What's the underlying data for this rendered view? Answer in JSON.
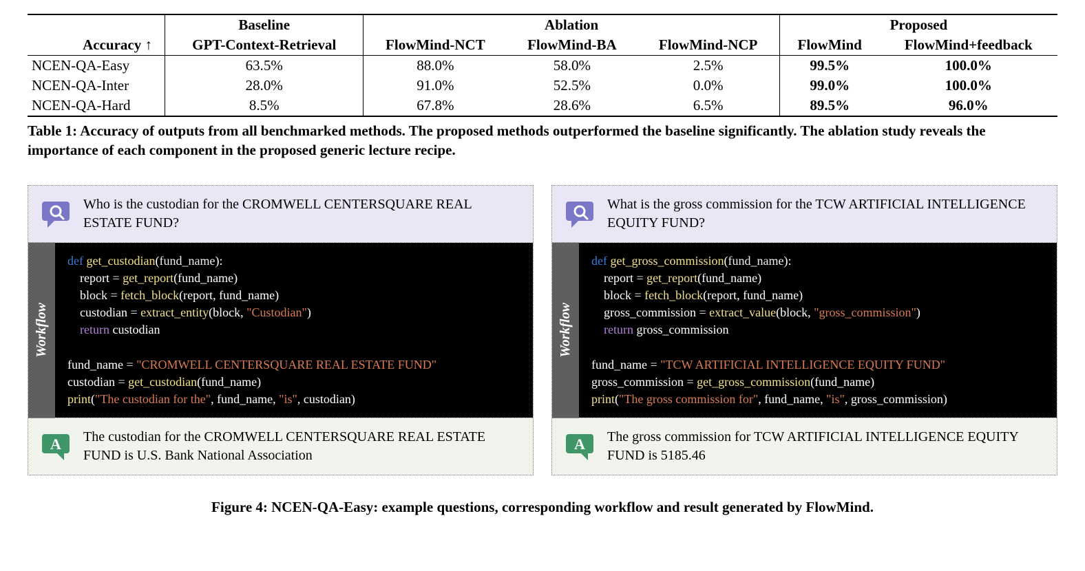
{
  "table": {
    "acc_label": "Accuracy ↑",
    "groups": {
      "baseline": "Baseline",
      "ablation": "Ablation",
      "proposed": "Proposed"
    },
    "cols": {
      "gpt": "GPT-Context-Retrieval",
      "nct": "FlowMind-NCT",
      "ba": "FlowMind-BA",
      "ncp": "FlowMind-NCP",
      "fm": "FlowMind",
      "fmf": "FlowMind+feedback"
    },
    "rows": [
      {
        "label": "NCEN-QA-Easy",
        "gpt": "63.5%",
        "nct": "88.0%",
        "ba": "58.0%",
        "ncp": "2.5%",
        "fm": "99.5%",
        "fmf": "100.0%"
      },
      {
        "label": "NCEN-QA-Inter",
        "gpt": "28.0%",
        "nct": "91.0%",
        "ba": "52.5%",
        "ncp": "0.0%",
        "fm": "99.0%",
        "fmf": "100.0%"
      },
      {
        "label": "NCEN-QA-Hard",
        "gpt": "8.5%",
        "nct": "67.8%",
        "ba": "28.6%",
        "ncp": "6.5%",
        "fm": "89.5%",
        "fmf": "96.0%"
      }
    ],
    "caption": "Table 1: Accuracy of outputs from all benchmarked methods. The proposed methods outperformed the baseline significantly. The ablation study reveals the importance of each component in the proposed generic lecture recipe."
  },
  "examples": [
    {
      "question": "Who is the custodian for the CROMWELL CENTERSQUARE REAL ESTATE FUND?",
      "workflow_label": "Workflow",
      "code_html": "<span class='kw'>def</span> <span class='fn'>get_custodian</span>(<span class='var'>fund_name</span>):\n    report <span class='eq'>=</span> <span class='fn'>get_report</span>(fund_name)\n    block <span class='eq'>=</span> <span class='fn'>fetch_block</span>(report, fund_name)\n    custodian <span class='eq'>=</span> <span class='fn'>extract_entity</span>(block, <span class='str'>\"Custodian\"</span>)\n    <span class='ret'>return</span> custodian\n\nfund_name <span class='eq'>=</span> <span class='str'>\"CROMWELL CENTERSQUARE REAL ESTATE FUND\"</span>\ncustodian <span class='eq'>=</span> <span class='fn'>get_custodian</span>(fund_name)\n<span class='fn'>print</span>(<span class='str'>\"The custodian for the\"</span>, fund_name, <span class='str'>\"is\"</span>, custodian)",
      "answer": "The custodian for the CROMWELL CENTERSQUARE REAL ESTATE FUND is U.S. Bank National Association"
    },
    {
      "question": "What is the gross commission for the TCW ARTIFICIAL INTELLIGENCE EQUITY FUND?",
      "workflow_label": "Workflow",
      "code_html": "<span class='kw'>def</span> <span class='fn'>get_gross_commission</span>(<span class='var'>fund_name</span>):\n    report <span class='eq'>=</span> <span class='fn'>get_report</span>(fund_name)\n    block <span class='eq'>=</span> <span class='fn'>fetch_block</span>(report, fund_name)\n    gross_commission <span class='eq'>=</span> <span class='fn'>extract_value</span>(block, <span class='str'>\"gross_commission\"</span>)\n    <span class='ret'>return</span> gross_commission\n\nfund_name <span class='eq'>=</span> <span class='str'>\"TCW ARTIFICIAL INTELLIGENCE EQUITY FUND\"</span>\ngross_commission <span class='eq'>=</span> <span class='fn'>get_gross_commission</span>(fund_name)\n<span class='fn'>print</span>(<span class='str'>\"The gross commission for\"</span>, fund_name, <span class='str'>\"is\"</span>, gross_commission)",
      "answer": "The gross commission for TCW ARTIFICIAL INTELLIGENCE EQUITY FUND is 5185.46"
    }
  ],
  "figure_caption": "Figure 4: NCEN-QA-Easy: example questions, corresponding workflow and result generated by FlowMind.",
  "chart_data": {
    "type": "table",
    "title": "Table 1: Accuracy of outputs from all benchmarked methods",
    "columns": [
      "GPT-Context-Retrieval",
      "FlowMind-NCT",
      "FlowMind-BA",
      "FlowMind-NCP",
      "FlowMind",
      "FlowMind+feedback"
    ],
    "column_groups": {
      "Baseline": [
        "GPT-Context-Retrieval"
      ],
      "Ablation": [
        "FlowMind-NCT",
        "FlowMind-BA",
        "FlowMind-NCP"
      ],
      "Proposed": [
        "FlowMind",
        "FlowMind+feedback"
      ]
    },
    "rows": [
      "NCEN-QA-Easy",
      "NCEN-QA-Inter",
      "NCEN-QA-Hard"
    ],
    "values_percent": [
      [
        63.5,
        88.0,
        58.0,
        2.5,
        99.5,
        100.0
      ],
      [
        28.0,
        91.0,
        52.5,
        0.0,
        99.0,
        100.0
      ],
      [
        8.5,
        67.8,
        28.6,
        6.5,
        89.5,
        96.0
      ]
    ],
    "metric": "Accuracy (higher is better)"
  }
}
